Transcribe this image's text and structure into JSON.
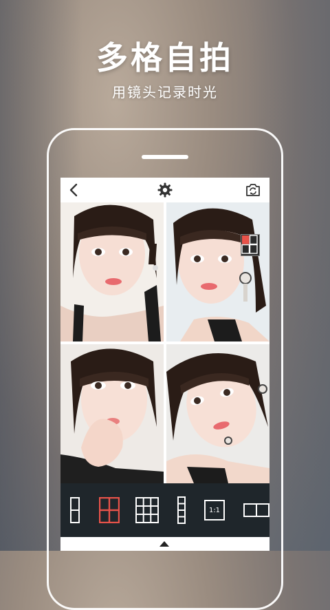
{
  "promo": {
    "title": "多格自拍",
    "subtitle": "用镜头记录时光"
  },
  "app_bar": {
    "back_icon": "chevron-left-icon",
    "settings_icon": "gear-icon",
    "switch_camera_icon": "camera-switch-icon"
  },
  "grid_layout_badge": "four-grid-layout-icon",
  "toolbar": {
    "layouts": [
      {
        "icon": "layout-two-vertical-icon",
        "selected": false
      },
      {
        "icon": "layout-four-grid-icon",
        "selected": true
      },
      {
        "icon": "layout-nine-grid-icon",
        "selected": false
      },
      {
        "icon": "layout-strip-icon",
        "selected": false
      },
      {
        "icon": "layout-ratio-icon",
        "label": "1:1",
        "selected": false
      },
      {
        "icon": "layout-two-horizontal-icon",
        "selected": false
      }
    ]
  },
  "colors": {
    "accent": "#e8534a",
    "toolbar_bg": "#1f262b",
    "app_bar_bg": "#ffffff"
  }
}
